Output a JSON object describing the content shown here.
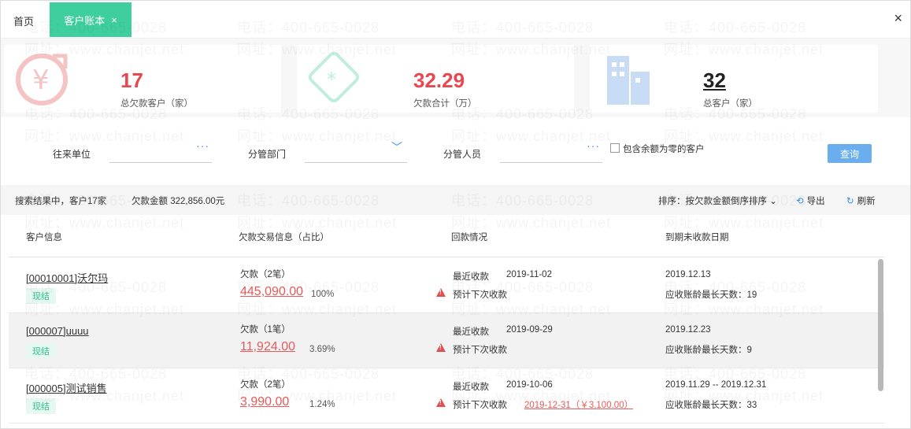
{
  "tabs": {
    "home": "首页",
    "active": "客户账本",
    "close": "×"
  },
  "window_close": "×",
  "watermark": {
    "phone": "电话：400-665-0028",
    "site": "网址：www.chanjet.net"
  },
  "summary": [
    {
      "value": "17",
      "label": "总欠款客户（家）",
      "color": "#e8474f",
      "icon": "yuan-arrow-icon"
    },
    {
      "value": "32.29",
      "label": "欠款合计（万）",
      "color": "#e8474f",
      "icon": "ticket-icon"
    },
    {
      "value": "32",
      "label": "总客户（家）",
      "color": "#222222",
      "icon": "building-icon"
    }
  ],
  "filters": {
    "unit_label": "往来单位",
    "dept_label": "分管部门",
    "staff_label": "分管人员",
    "include_zero_label": "包含余额为零的客户",
    "include_zero_checked": false,
    "search_button": "查询",
    "dots": "···",
    "chevron": "﹀"
  },
  "results": {
    "summary_text": "搜索结果中，客户17家",
    "amount_text": "欠款金额 322,856.00元",
    "sort_label": "排序：按欠款金额倒序排序",
    "export_label": "导出",
    "refresh_label": "刷新"
  },
  "table": {
    "headers": [
      "客户信息",
      "欠款交易信息（占比）",
      "回款情况",
      "到期未收款日期"
    ],
    "rows": [
      {
        "name": "[00010001]沃尔玛",
        "badge": "现结",
        "debt_title": "欠款（2笔）",
        "debt_amount": "445,090.00",
        "debt_pct": "100%",
        "recent_label": "最近收款",
        "recent_date": "2019-11-02",
        "next_label": "预计下次收款",
        "next_value": "",
        "due_date": "2019.12.13",
        "due_days": "应收账龄最长天数：19"
      },
      {
        "name": "[000007]uuuu",
        "badge": "现结",
        "debt_title": "欠款（1笔）",
        "debt_amount": "11,924.00",
        "debt_pct": "3.69%",
        "recent_label": "最近收款",
        "recent_date": "2019-09-29",
        "next_label": "预计下次收款",
        "next_value": "",
        "due_date": "2019.12.23",
        "due_days": "应收账龄最长天数：9"
      },
      {
        "name": "[000005]测试销售",
        "badge": "现结",
        "debt_title": "欠款（2笔）",
        "debt_amount": "3,990.00",
        "debt_pct": "1.24%",
        "recent_label": "最近收款",
        "recent_date": "2019-10-06",
        "next_label": "预计下次收款",
        "next_value": "2019-12-31（￥3,100.00）",
        "due_date": "2019.11.29 -- 2019.12.31",
        "due_days": "应收账龄最长天数：33"
      }
    ]
  }
}
